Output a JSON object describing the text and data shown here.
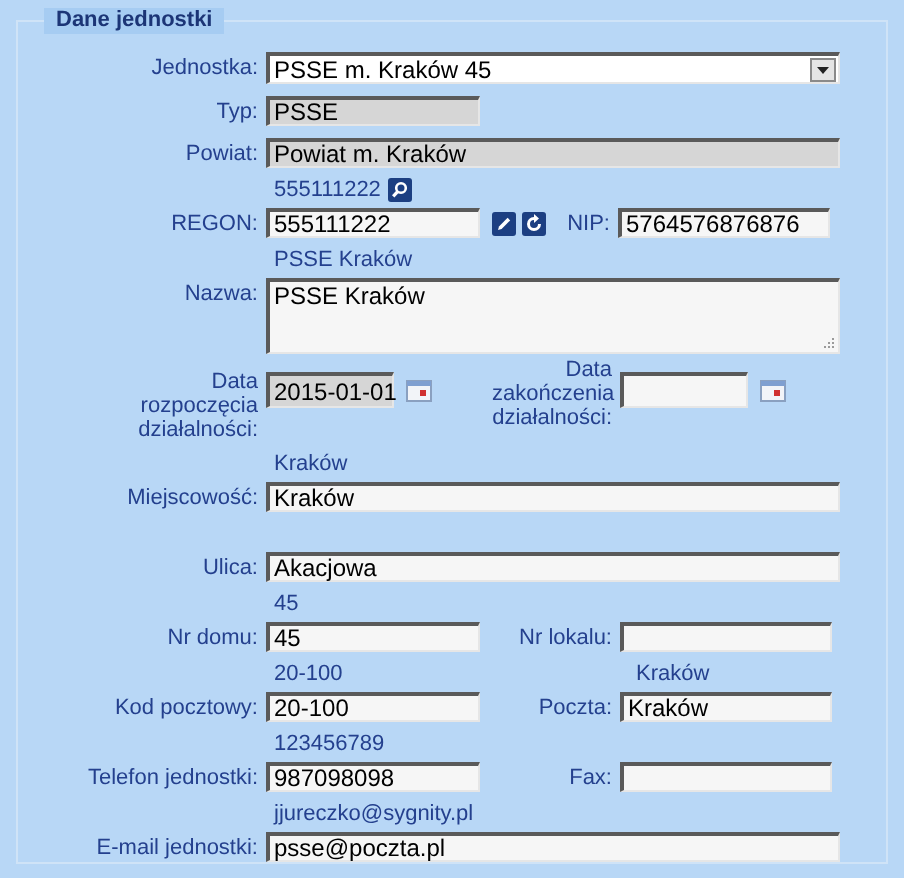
{
  "section": {
    "title": "Dane jednostki"
  },
  "rows": [
    {
      "kind": "plain",
      "left": {
        "kind": "select",
        "label": "Jednostka:",
        "value": "PSSE m. Kraków 45",
        "readonly": false,
        "wide": true
      }
    },
    {
      "kind": "plain",
      "left": {
        "kind": "text",
        "label": "Typ:",
        "value": "PSSE",
        "readonly": true,
        "wide": false
      }
    },
    {
      "kind": "plain",
      "left": {
        "kind": "text",
        "label": "Powiat:",
        "value": "Powiat m. Kraków",
        "readonly": true,
        "wide": true
      }
    },
    {
      "kind": "hinted",
      "left": {
        "kind": "lookup",
        "label": "REGON:",
        "value": "555111222",
        "hint": "555111222",
        "readonly": false,
        "wide": false
      },
      "right": {
        "kind": "text",
        "label": "NIP:",
        "value": "5764576876876",
        "readonly": false
      }
    },
    {
      "kind": "hinted",
      "left": {
        "kind": "textarea",
        "label": "Nazwa:",
        "value": "PSSE Kraków",
        "hint": "PSSE Kraków",
        "readonly": false,
        "wide": true
      }
    },
    {
      "kind": "dates",
      "left": {
        "kind": "date",
        "label": "Data rozpoczęcia działalności:",
        "value": "2015-01-01",
        "readonly": true
      },
      "right": {
        "kind": "date",
        "label": "Data zakończenia działalności:",
        "readonly": false
      }
    },
    {
      "kind": "hinted",
      "left": {
        "kind": "text",
        "label": "Miejscowość:",
        "value": "Kraków",
        "hint": "Kraków",
        "readonly": false,
        "wide": true
      }
    },
    {
      "kind": "hinted",
      "left": {
        "kind": "text",
        "label": "Ulica:",
        "value": "Akacjowa",
        "readonly": false,
        "wide": true
      }
    },
    {
      "kind": "hinted",
      "left": {
        "kind": "text",
        "label": "Nr domu:",
        "value": "45",
        "hint": "45",
        "readonly": false,
        "wide": false
      },
      "right": {
        "kind": "text",
        "label": "Nr lokalu:",
        "readonly": false
      }
    },
    {
      "kind": "hinted",
      "left": {
        "kind": "text",
        "label": "Kod pocztowy:",
        "value": "20-100",
        "hint": "20-100",
        "readonly": false,
        "wide": false
      },
      "right": {
        "kind": "text",
        "label": "Poczta:",
        "value": "Kraków",
        "hint": "Kraków",
        "readonly": false
      }
    },
    {
      "kind": "hinted",
      "left": {
        "kind": "text",
        "label": "Telefon jednostki:",
        "value": "987098098",
        "hint": "123456789",
        "readonly": false,
        "wide": false
      },
      "right": {
        "kind": "text",
        "label": "Fax:",
        "readonly": false
      }
    },
    {
      "kind": "hinted",
      "left": {
        "kind": "text",
        "label": "E-mail jednostki:",
        "value": "psse@poczta.pl",
        "hint": "jjureczko@sygnity.pl",
        "readonly": false,
        "wide": true
      }
    }
  ]
}
